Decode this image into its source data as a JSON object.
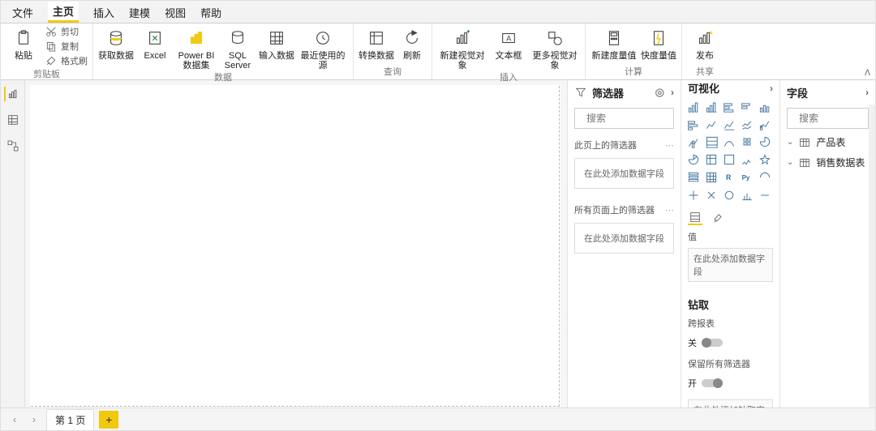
{
  "tabs": {
    "file": "文件",
    "home": "主页",
    "insert": "插入",
    "model": "建模",
    "view": "视图",
    "help": "帮助"
  },
  "ribbon": {
    "group_clipboard": {
      "label": "剪贴板",
      "paste": "粘贴",
      "cut": "剪切",
      "copy": "复制",
      "format": "格式刷"
    },
    "group_data": {
      "label": "数据",
      "get_data": "获取数据",
      "excel": "Excel",
      "powerbi": "Power BI\n数据集",
      "sql": "SQL\nServer",
      "enter": "输入数据",
      "recent": "最近使用的源"
    },
    "group_query": {
      "label": "查询",
      "transform": "转换数据",
      "refresh": "刷新"
    },
    "group_insert": {
      "label": "插入",
      "newvis": "新建视觉对象",
      "textbox": "文本框",
      "morevis": "更多视觉对象"
    },
    "group_calc": {
      "label": "计算",
      "measure": "新建度量值",
      "quick": "快度量值"
    },
    "group_share": {
      "label": "共享",
      "publish": "发布"
    }
  },
  "filters": {
    "title": "筛选器",
    "search_placeholder": "搜索",
    "page_filters": "此页上的筛选器",
    "all_pages": "所有页面上的筛选器",
    "drop_hint": "在此处添加数据字段"
  },
  "viz": {
    "title": "可视化",
    "values": "值",
    "values_hint": "在此处添加数据字段",
    "drill": "钻取",
    "cross_report": "跨报表",
    "off": "关",
    "on": "开",
    "keep_all": "保留所有筛选器",
    "drill_hint": "在此处添加钻取字段"
  },
  "fields": {
    "title": "字段",
    "search_placeholder": "搜索",
    "tables": [
      "产品表",
      "销售数据表"
    ]
  },
  "bottom": {
    "page1": "第 1 页"
  }
}
